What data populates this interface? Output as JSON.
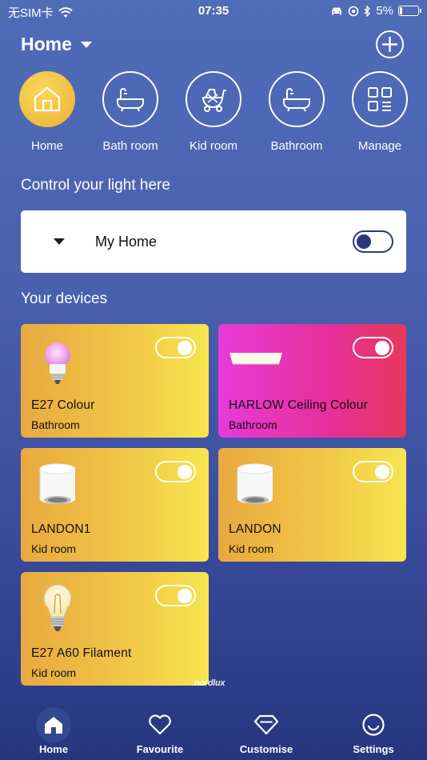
{
  "status": {
    "carrier": "无SIM卡",
    "time": "07:35",
    "battery": "5%"
  },
  "header": {
    "title": "Home"
  },
  "rooms": [
    {
      "label": "Home",
      "icon": "house-icon"
    },
    {
      "label": "Bath room",
      "icon": "bathtub-icon"
    },
    {
      "label": "Kid room",
      "icon": "stroller-icon"
    },
    {
      "label": "Bathroom",
      "icon": "bathtub-icon"
    },
    {
      "label": "Manage",
      "icon": "grid-icon"
    }
  ],
  "control": {
    "title": "Control your light here",
    "home_name": "My Home"
  },
  "devices_title": "Your devices",
  "devices": [
    {
      "name": "E27 Colour",
      "room": "Bathroom",
      "icon": "color-bulb-icon"
    },
    {
      "name": "HARLOW Ceiling Colour",
      "room": "Bathroom",
      "icon": "ceiling-panel-icon"
    },
    {
      "name": "LANDON1",
      "room": "Kid room",
      "icon": "downlight-icon"
    },
    {
      "name": "LANDON",
      "room": "Kid room",
      "icon": "downlight-icon"
    },
    {
      "name": "E27 A60 Filament",
      "room": "Kid room",
      "icon": "filament-bulb-icon"
    }
  ],
  "brand": "nordlux",
  "tabs": [
    {
      "label": "Home",
      "icon": "home-icon"
    },
    {
      "label": "Favourite",
      "icon": "heart-icon"
    },
    {
      "label": "Customise",
      "icon": "diamond-icon"
    },
    {
      "label": "Settings",
      "icon": "smiley-icon"
    }
  ],
  "colors": {
    "accent_yellow": "#eab133",
    "card_pink": "#e63099",
    "toggle_dark": "#2c3b78"
  }
}
